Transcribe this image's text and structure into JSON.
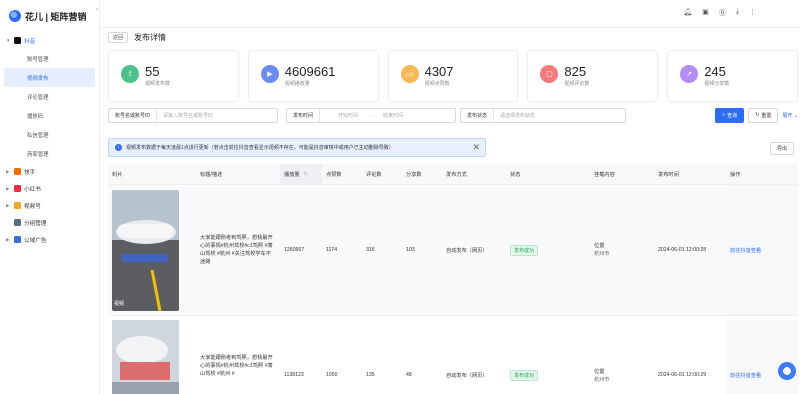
{
  "brand": {
    "name": "花儿 | 矩阵营销"
  },
  "sidebar": {
    "douyin": {
      "label": "抖音",
      "items": [
        "账号管理",
        "视频发布",
        "评论管理",
        "播放码",
        "私信管理",
        "商家管理"
      ]
    },
    "platforms": [
      {
        "label": "快手",
        "color": "#ff6a00"
      },
      {
        "label": "小红书",
        "color": "#ff2442"
      },
      {
        "label": "视频号",
        "color": "#f5a623"
      },
      {
        "label": "分组管理",
        "color": "#5a6b85"
      },
      {
        "label": "公域广告",
        "color": "#3b6fd8"
      }
    ]
  },
  "topbar": {
    "icons": [
      "bell-icon",
      "gift-icon",
      "help-icon",
      "download-icon",
      "more-icon"
    ]
  },
  "page": {
    "back_label": "返回",
    "title": "发布详情"
  },
  "stats": [
    {
      "value": "55",
      "label": "视频发布数",
      "color": "#4cc38a"
    },
    {
      "value": "4609661",
      "label": "视频播放量",
      "color": "#6c8cf5"
    },
    {
      "value": "4307",
      "label": "视频点赞数",
      "color": "#f7b955"
    },
    {
      "value": "825",
      "label": "视频评论数",
      "color": "#f77a7a"
    },
    {
      "value": "245",
      "label": "视频分享数",
      "color": "#b48cf7"
    }
  ],
  "filters": {
    "account_label": "账号名或账号ID",
    "account_placeholder": "请输入账号名或账号ID",
    "time_label": "发布时间",
    "start_placeholder": "开始时间",
    "arrow": "→",
    "end_placeholder": "结束时间",
    "status_label": "发布状态",
    "status_placeholder": "请选择发布状态",
    "search_label": "查询",
    "reset_label": "重置",
    "expand_label": "展开 ⌄"
  },
  "notice": {
    "text": "视频发布数据于每天凌晨1点进行更新（若点击前往抖音查看显示视频不存在，可能是抖音审核中或用户已主动删除导致）"
  },
  "export_label": "导出",
  "table": {
    "headers": [
      "封片",
      "标题/描述",
      "播放量",
      "点赞数",
      "评论数",
      "分享数",
      "发布方式",
      "状态",
      "挂载内容",
      "发布时间",
      "操作"
    ],
    "rows": [
      {
        "thumb_label": "视频",
        "title": "大家能跟刚考到驾照，想我最开心的事情#杭州驾校#c1驾照 #萧山驾校 #杭州 #关注驾校学车不迷路",
        "plays": "1260667",
        "likes": "1174",
        "comments": "316",
        "shares": "103",
        "method": "自动发布（网页）",
        "status": "发布成功",
        "mount_1": "位置",
        "mount_2": "杭州市",
        "time": "2024-06-01 12:00:28",
        "action": "前往抖音查看"
      },
      {
        "thumb_label": "",
        "title": "大家能跟刚考到驾照，想我最开心的事情#杭州驾校#c1驾照 #萧山驾校 #杭州 #",
        "plays": "1138123",
        "likes": "1050",
        "comments": "135",
        "shares": "48",
        "method": "自动发布（网页）",
        "status": "发布成功",
        "mount_1": "位置",
        "mount_2": "杭州市",
        "time": "2024-06-01 12:00:29",
        "action": "前往抖音查看"
      }
    ]
  },
  "float_button": {
    "label": "AI"
  }
}
